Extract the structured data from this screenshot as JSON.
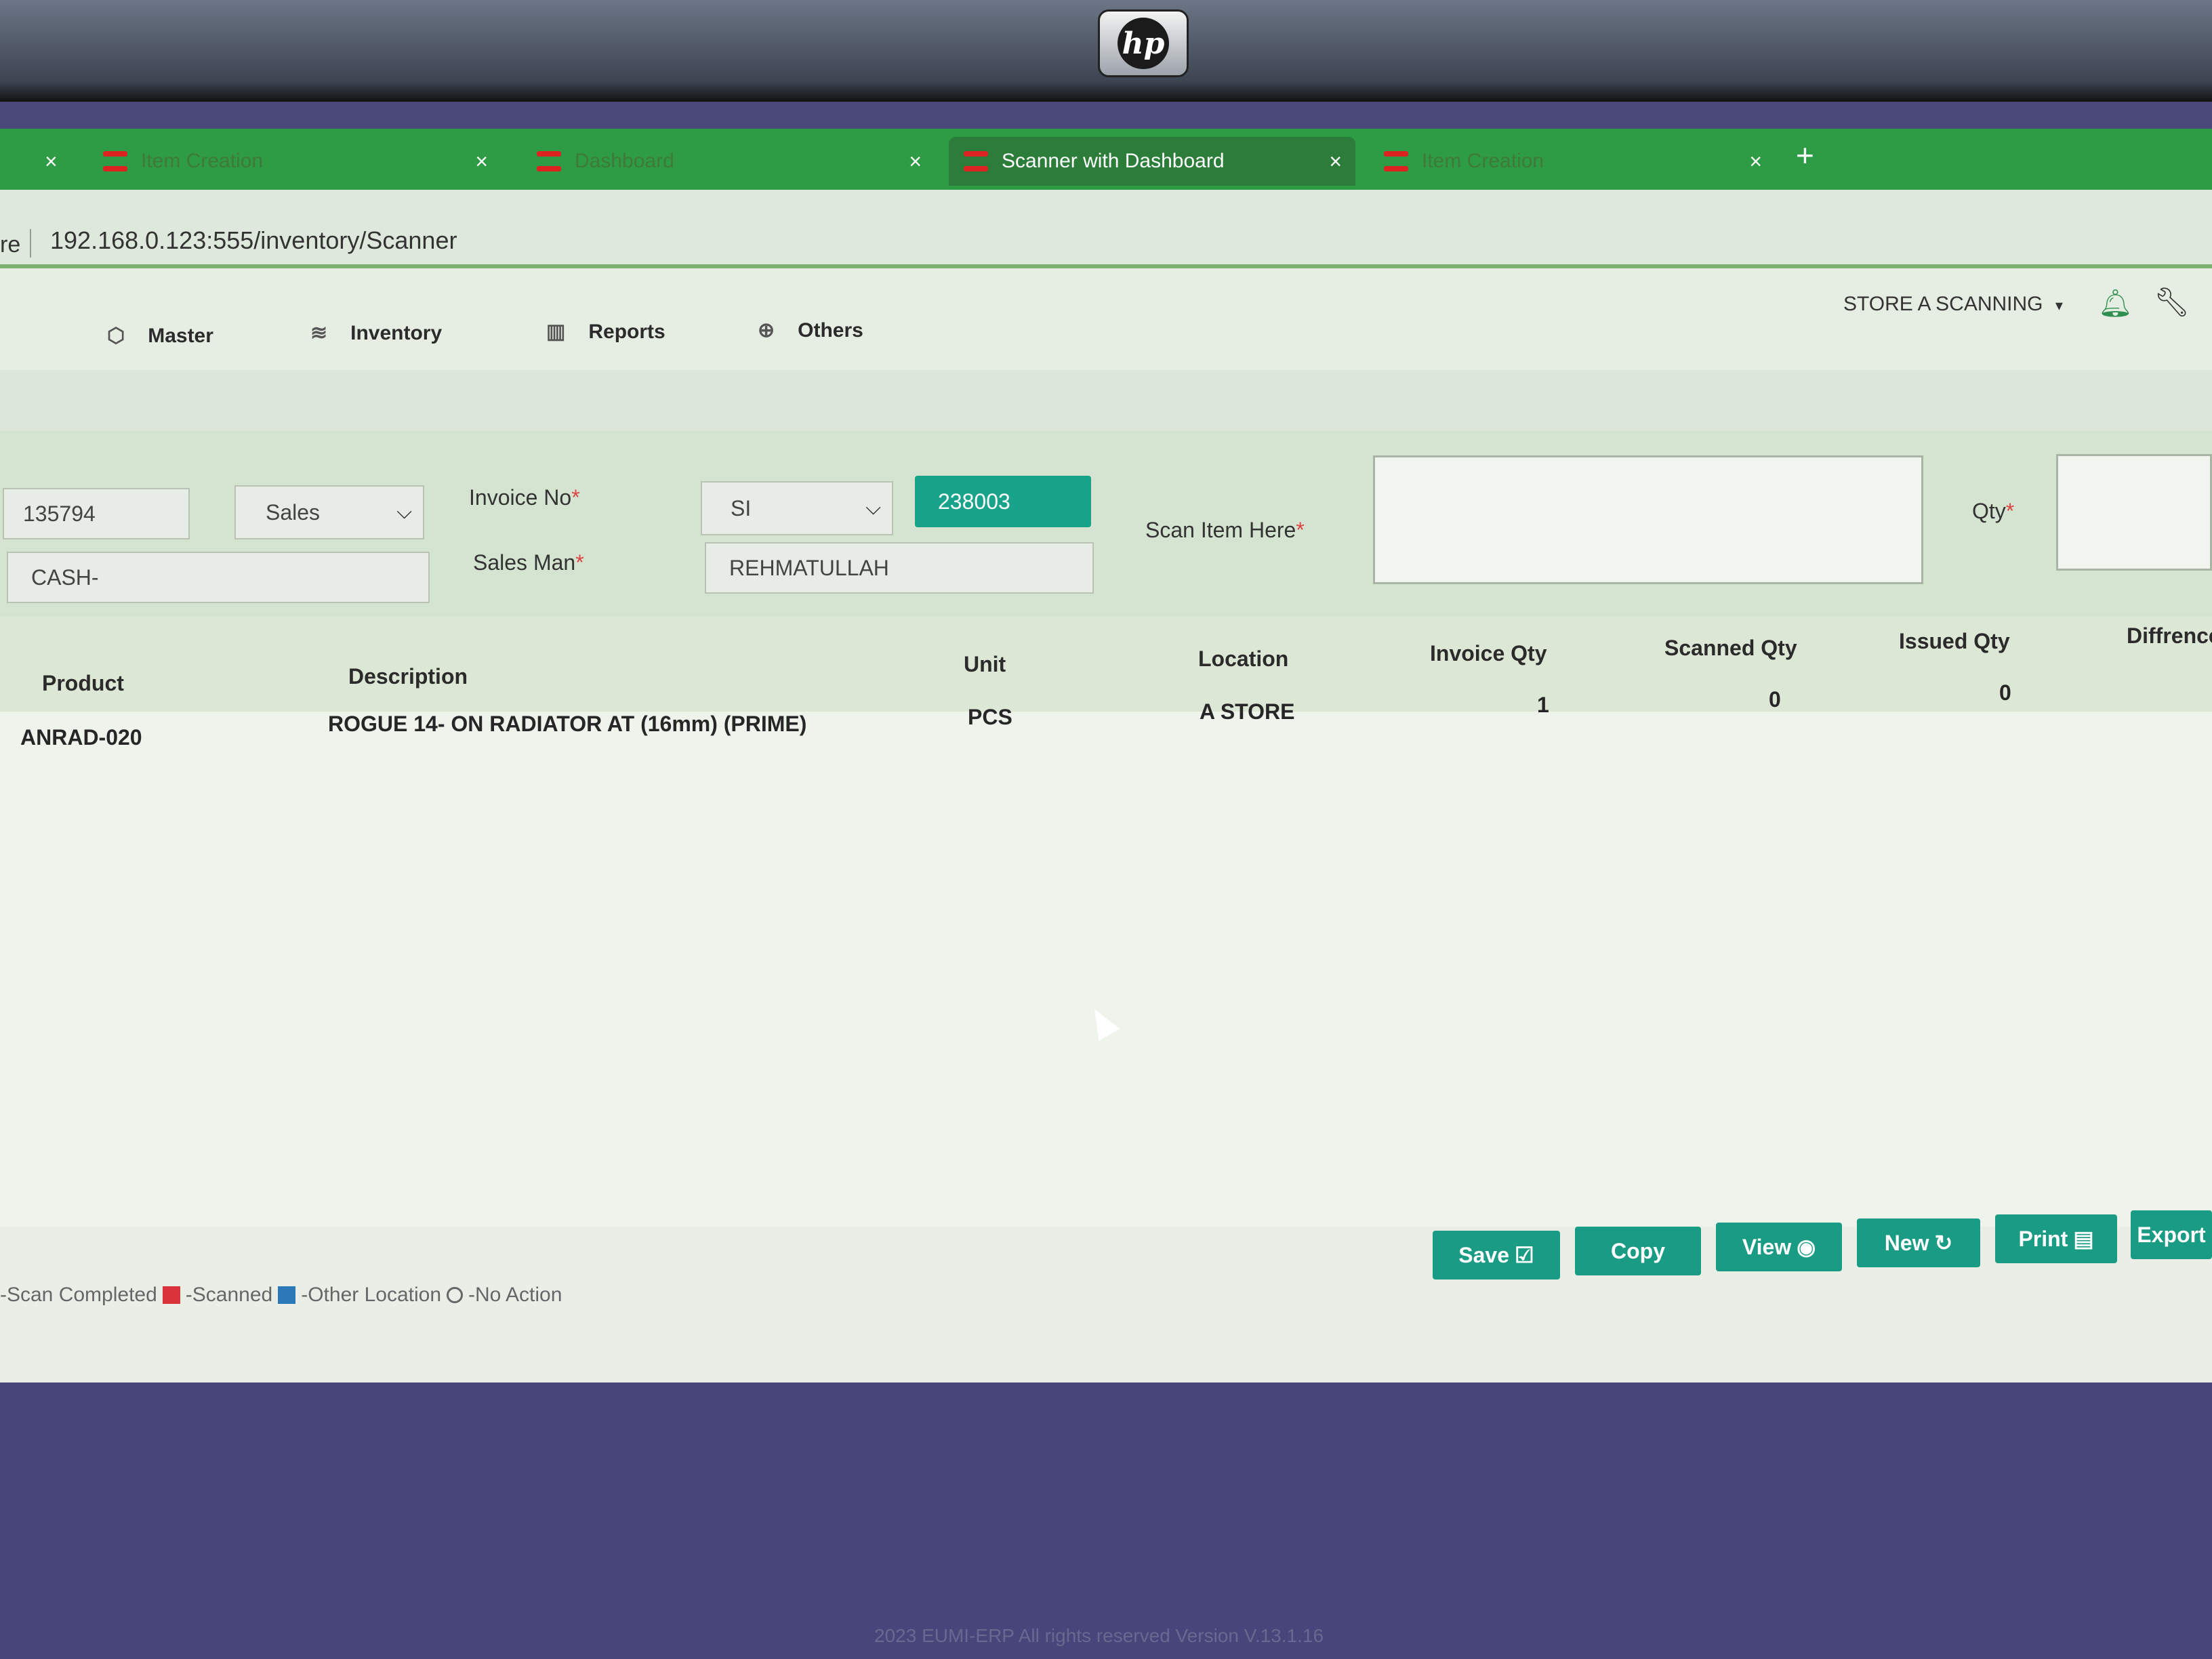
{
  "browser": {
    "tabs": [
      {
        "label": "Item Creation",
        "active": false
      },
      {
        "label": "Dashboard",
        "active": false
      },
      {
        "label": "Scanner with Dashboard",
        "active": true
      },
      {
        "label": "Item Creation",
        "active": false
      }
    ],
    "close_glyph": "×",
    "new_tab_glyph": "+",
    "address_prefix": "re",
    "address": "192.168.0.123:555/inventory/Scanner"
  },
  "laptop_logo": "hp",
  "nav": {
    "items": [
      {
        "label": "Master",
        "icon": "cube-icon"
      },
      {
        "label": "Inventory",
        "icon": "layers-icon"
      },
      {
        "label": "Reports",
        "icon": "bar-chart-icon"
      },
      {
        "label": "Others",
        "icon": "globe-icon"
      }
    ],
    "store_label": "STORE A SCANNING",
    "store_caret": "▾"
  },
  "form": {
    "doc_number": "135794",
    "doc_type": "Sales",
    "customer": "CASH-",
    "invoice_label": "Invoice No",
    "invoice_prefix": "SI",
    "invoice_number": "238003",
    "salesman_label": "Sales Man",
    "salesman": "REHMATULLAH",
    "scan_label": "Scan Item Here",
    "scan_value": "",
    "qty_label": "Qty",
    "required_mark": "*"
  },
  "table": {
    "headers": [
      "Product",
      "Description",
      "Unit",
      "Location",
      "Invoice Qty",
      "Scanned Qty",
      "Issued Qty",
      "Diffrence"
    ],
    "rows": [
      {
        "product": "ANRAD-020",
        "description": "ROGUE 14- ON RADIATOR AT (16mm) (PRIME)",
        "unit": "PCS",
        "location": "A STORE",
        "invoice_qty": "1",
        "scanned_qty": "0",
        "issued_qty": "0"
      }
    ]
  },
  "actions": {
    "save": "Save",
    "copy": "Copy",
    "view": "View",
    "new": "New",
    "print": "Print",
    "export": "Export"
  },
  "legend": {
    "scan_completed": "-Scan Completed",
    "scanned": "-Scanned",
    "other_location": "-Other Location",
    "no_action": "-No Action",
    "colors": {
      "scanned": "#d9343b",
      "other_location": "#2a78b8"
    }
  },
  "footer": "2023 EUMI-ERP All rights reserved Version V.13.1.16",
  "colors": {
    "tab_green": "#2e9b45",
    "accent_teal": "#1a9b84"
  }
}
